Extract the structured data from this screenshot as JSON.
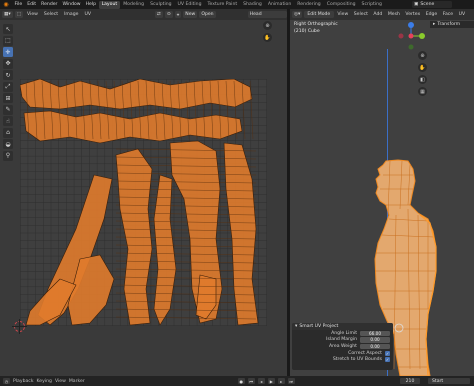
{
  "topbar": {
    "menus": [
      "File",
      "Edit",
      "Render",
      "Window",
      "Help"
    ],
    "workspace_tabs": [
      "Layout",
      "Modeling",
      "Sculpting",
      "UV Editing",
      "Texture Paint",
      "Shading",
      "Animation",
      "Rendering",
      "Compositing",
      "Scripting"
    ],
    "active_tab": "Layout",
    "scene": "Scene"
  },
  "uv_editor": {
    "mode_menus": [
      "View",
      "Select",
      "Image",
      "UV"
    ],
    "new_label": "New",
    "open_label": "Open",
    "image_name": "Head",
    "accent": "#e07b2c"
  },
  "viewport": {
    "mode": "Edit Mode",
    "menus": [
      "View",
      "Select",
      "Add",
      "Mesh",
      "Vertex",
      "Edge",
      "Face",
      "UV"
    ],
    "view_name": "Right Orthographic",
    "object_name": "(210) Cube",
    "transform_label": "Transform",
    "gizmo": {
      "x_color": "#e8415b",
      "y_color": "#8acb2c",
      "z_color": "#3b7de9"
    }
  },
  "operator": {
    "title": "Smart UV Project",
    "angle_limit_label": "Angle Limit",
    "angle_limit_value": "66.00",
    "island_margin_label": "Island Margin",
    "island_margin_value": "0.00",
    "area_weight_label": "Area Weight",
    "area_weight_value": "0.00",
    "correct_aspect_label": "Correct Aspect",
    "stretch_label": "Stretch to UV Bounds"
  },
  "statusbar": {
    "playback": "Playback",
    "keying": "Keying",
    "view": "View",
    "marker": "Marker",
    "frame": "210",
    "start_label": "Start"
  }
}
